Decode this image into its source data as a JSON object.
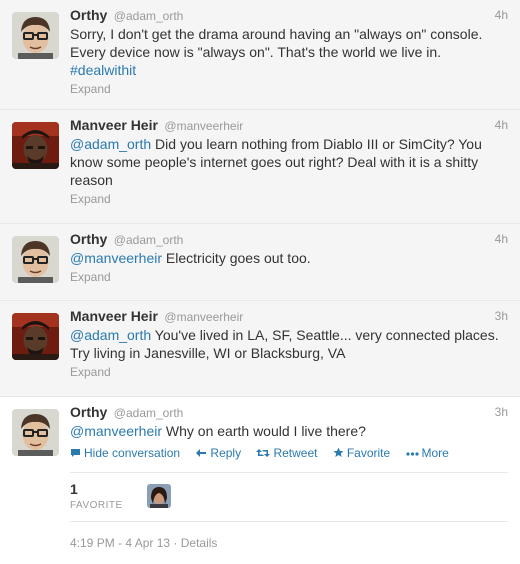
{
  "tweets": [
    {
      "name": "Orthy",
      "handle": "@adam_orth",
      "time": "4h",
      "text_before": "Sorry, I don't get the drama around having an \"always on\" console. Every device now is \"always on\". That's the world we live in. ",
      "mention": "",
      "text_after": "",
      "hashtag": "#dealwithit",
      "expand": "Expand"
    },
    {
      "name": "Manveer Heir",
      "handle": "@manveerheir",
      "time": "4h",
      "mention": "@adam_orth",
      "text_after": " Did you learn nothing from Diablo III or SimCity? You know some people's internet goes out right? Deal with it is a shitty reason",
      "expand": "Expand"
    },
    {
      "name": "Orthy",
      "handle": "@adam_orth",
      "time": "4h",
      "mention": "@manveerheir",
      "text_after": " Electricity goes out too.",
      "expand": "Expand"
    },
    {
      "name": "Manveer Heir",
      "handle": "@manveerheir",
      "time": "3h",
      "mention": "@adam_orth",
      "text_after": " You've lived in LA, SF, Seattle... very connected places. Try living in Janesville, WI or Blacksburg, VA",
      "expand": "Expand"
    },
    {
      "name": "Orthy",
      "handle": "@adam_orth",
      "time": "3h",
      "mention": "@manveerheir",
      "text_after": " Why on earth would I live there?"
    }
  ],
  "actions": {
    "hide": "Hide conversation",
    "reply": "Reply",
    "retweet": "Retweet",
    "favorite": "Favorite",
    "more": "More"
  },
  "stats": {
    "count": "1",
    "label": "FAVORITE"
  },
  "footer": {
    "timestamp": "4:19 PM - 4 Apr 13",
    "separator": " · ",
    "details": "Details"
  },
  "colors": {
    "link": "#2a7ab0",
    "meta": "#999999",
    "alt_background": "#f5f5f5"
  },
  "icons": {
    "hide": "speech-bubble-icon",
    "reply": "reply-arrow-icon",
    "retweet": "retweet-icon",
    "favorite": "star-icon",
    "more": "dots-icon"
  }
}
